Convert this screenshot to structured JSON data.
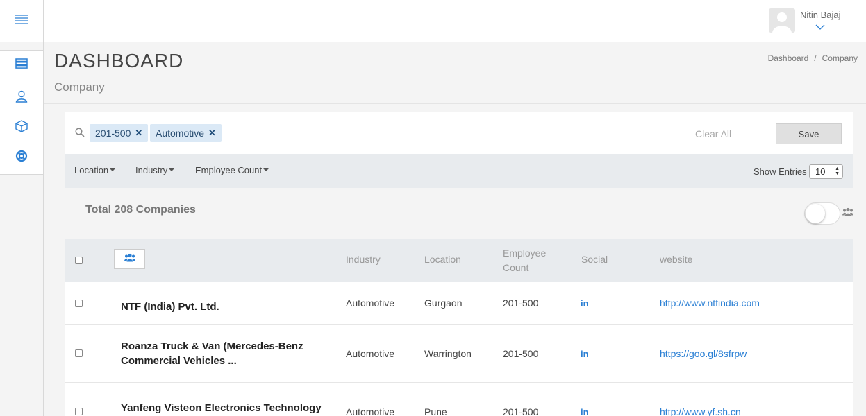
{
  "header": {
    "user_name": "Nitin Bajaj"
  },
  "page": {
    "title": "DASHBOARD",
    "subtitle": "Company",
    "breadcrumb": [
      "Dashboard",
      "Company"
    ]
  },
  "filters": {
    "chips": [
      "201-500",
      "Automotive"
    ],
    "clear_all": "Clear All",
    "save": "Save",
    "dropdowns": [
      "Location",
      "Industry",
      "Employee Count"
    ],
    "show_entries_label": "Show Entries",
    "show_entries_value": "10"
  },
  "summary": {
    "total": "Total 208 Companies"
  },
  "table": {
    "headers": [
      "Industry",
      "Location",
      "Employee\nCount",
      "Social",
      "website"
    ],
    "rows": [
      {
        "name": "NTF (India) Pvt. Ltd.",
        "industry": "Automotive",
        "location": "Gurgaon",
        "count": "201-500",
        "social": "in",
        "website": "http://www.ntfindia.com"
      },
      {
        "name": "Roanza Truck & Van (Mercedes-Benz Commercial Vehicles ...",
        "industry": "Automotive",
        "location": "Warrington",
        "count": "201-500",
        "social": "in",
        "website": "https://goo.gl/8sfrpw"
      },
      {
        "name": "Yanfeng Visteon Electronics Technology",
        "industry": "Automotive",
        "location": "Pune",
        "count": "201-500",
        "social": "in",
        "website": "http://www.yf.sh.cn"
      }
    ]
  },
  "icons": {
    "menu": "hamburger-icon",
    "nav": [
      "server-icon",
      "user-icon",
      "box-icon",
      "lifebuoy-icon"
    ],
    "accent": "#2a7fd4"
  }
}
